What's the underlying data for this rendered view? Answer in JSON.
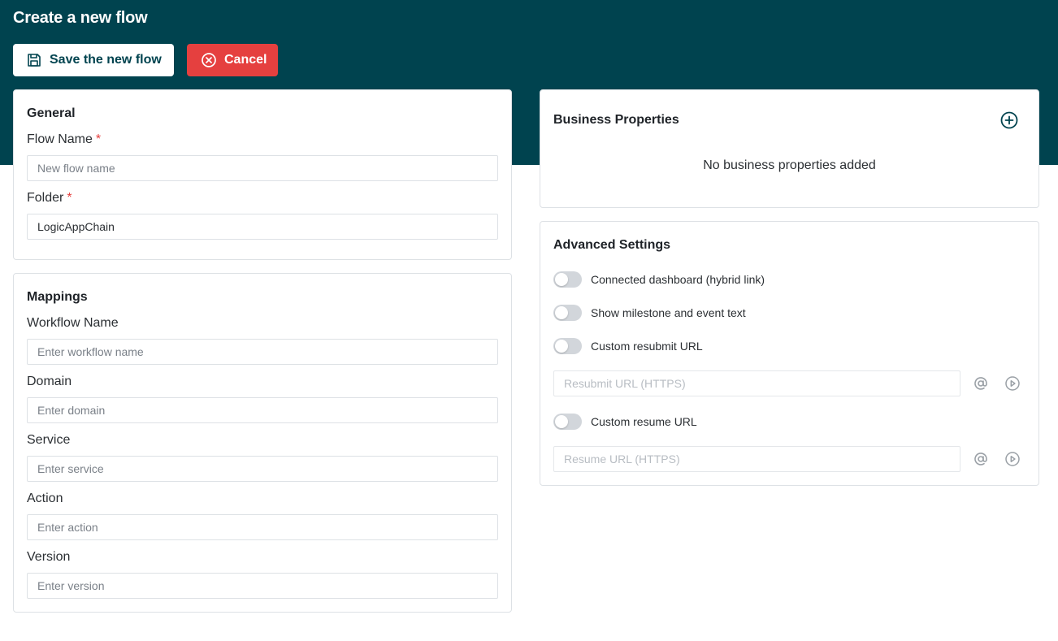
{
  "header": {
    "title": "Create a new flow",
    "save_label": "Save the new flow",
    "cancel_label": "Cancel"
  },
  "general": {
    "title": "General",
    "flow_name_label": "Flow Name",
    "flow_name_placeholder": "New flow name",
    "flow_name_value": "",
    "folder_label": "Folder",
    "folder_value": "LogicAppChain",
    "required_marker": "*"
  },
  "mappings": {
    "title": "Mappings",
    "fields": [
      {
        "label": "Workflow Name",
        "placeholder": "Enter workflow name"
      },
      {
        "label": "Domain",
        "placeholder": "Enter domain"
      },
      {
        "label": "Service",
        "placeholder": "Enter service"
      },
      {
        "label": "Action",
        "placeholder": "Enter action"
      },
      {
        "label": "Version",
        "placeholder": "Enter version"
      }
    ]
  },
  "business": {
    "title": "Business Properties",
    "empty_text": "No business properties added",
    "add_icon": "plus-circle-icon"
  },
  "advanced": {
    "title": "Advanced Settings",
    "toggles": [
      {
        "label": "Connected dashboard (hybrid link)",
        "on": false
      },
      {
        "label": "Show milestone and event text",
        "on": false
      },
      {
        "label": "Custom resubmit URL",
        "on": false
      },
      {
        "label": "Custom resume URL",
        "on": false
      }
    ],
    "resubmit_placeholder": "Resubmit URL (HTTPS)",
    "resume_placeholder": "Resume URL (HTTPS)"
  },
  "colors": {
    "header_bg": "#00434f",
    "cancel_bg": "#e5403f",
    "required": "#e5403f"
  }
}
